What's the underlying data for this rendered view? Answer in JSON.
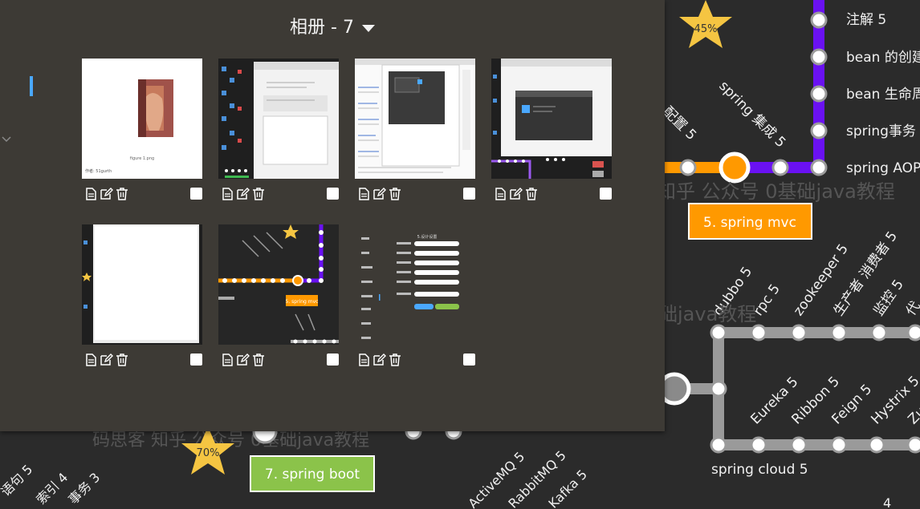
{
  "album": {
    "title": "相册 - 7",
    "photos": [
      {
        "alt": "photo-1",
        "caption_left": "作者: 51gurth",
        "caption_center": "figure 1.png"
      },
      {
        "alt": "photo-2"
      },
      {
        "alt": "photo-3"
      },
      {
        "alt": "photo-4"
      },
      {
        "alt": "photo-5"
      },
      {
        "alt": "photo-6",
        "mini_label": "5. spring mvc"
      },
      {
        "alt": "photo-7",
        "mini_title": "5.设计设置"
      }
    ]
  },
  "background_map": {
    "top_line_labels": [
      "注解 5",
      "bean 的创建",
      "bean 生命周期",
      "spring事务",
      "spring AOP"
    ],
    "diagonal_labels": [
      "spring 集成 5",
      "配置 5"
    ],
    "watermarks": [
      "知乎 公众号 0基础java教程",
      "础java教程",
      "码思客 知乎 公众号 0基础java教程"
    ],
    "stars": [
      "45%",
      "70%"
    ],
    "mvc_label": "5. spring mvc",
    "boot_label": "7. spring boot",
    "distributed_labels": [
      "dubbo 5",
      "rpc 5",
      "zookeeper 5",
      "生产者 消费者 5",
      "监控 5",
      "代"
    ],
    "cloud_labels": [
      "Eureka 5",
      "Ribbon 5",
      "Feign 5",
      "Hystrix 5",
      "Zu"
    ],
    "spring_cloud_label": "spring cloud 5",
    "mq_labels": [
      "ActiveMQ 5",
      "RabbitMQ 5",
      "Kafka 5"
    ],
    "db_labels": [
      "语句 5",
      "索引 4",
      "事务 3"
    ],
    "corner_number": "4"
  },
  "colors": {
    "panel_bg": "#3d3a35",
    "purple_line": "#6a11f2",
    "orange_line": "#ff9900",
    "gray_line": "#9a9a9a",
    "mvc_box": "#ff9900",
    "boot_box": "#8bc34a",
    "star": "#f5c542",
    "accent_blue": "#4aa8ff"
  }
}
